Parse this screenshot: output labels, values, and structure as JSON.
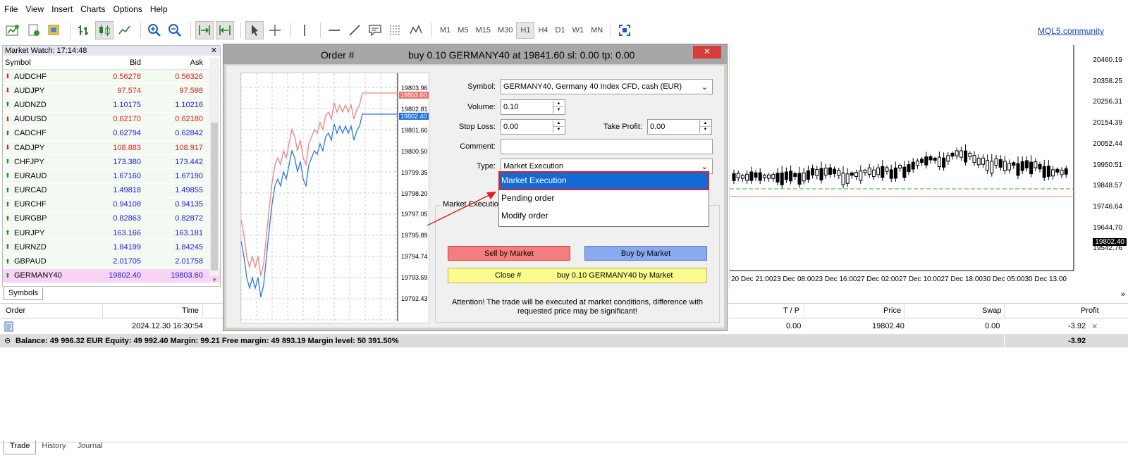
{
  "menu": [
    "File",
    "View",
    "Insert",
    "Charts",
    "Options",
    "Help"
  ],
  "toolbar": {
    "timeframes": [
      "M1",
      "M5",
      "M15",
      "M30",
      "H1",
      "H4",
      "D1",
      "W1",
      "MN"
    ],
    "active_timeframe": "H1",
    "community_link": "MQL5.community"
  },
  "market_watch": {
    "title": "Market Watch: 17:14:48",
    "col_symbol": "Symbol",
    "col_bid": "Bid",
    "col_ask": "Ask",
    "rows": [
      {
        "symbol": "AUDCHF",
        "dir": "down",
        "bid": "0.56278",
        "ask": "0.56326"
      },
      {
        "symbol": "AUDJPY",
        "dir": "down",
        "bid": "97.574",
        "ask": "97.598"
      },
      {
        "symbol": "AUDNZD",
        "dir": "up",
        "bid": "1.10175",
        "ask": "1.10216"
      },
      {
        "symbol": "AUDUSD",
        "dir": "down",
        "bid": "0.62170",
        "ask": "0.62180"
      },
      {
        "symbol": "CADCHF",
        "dir": "up",
        "bid": "0.62794",
        "ask": "0.62842"
      },
      {
        "symbol": "CADJPY",
        "dir": "down",
        "bid": "108.883",
        "ask": "108.917"
      },
      {
        "symbol": "CHFJPY",
        "dir": "up",
        "bid": "173.380",
        "ask": "173.442"
      },
      {
        "symbol": "EURAUD",
        "dir": "up",
        "bid": "1.67160",
        "ask": "1.67190"
      },
      {
        "symbol": "EURCAD",
        "dir": "up",
        "bid": "1.49818",
        "ask": "1.49855"
      },
      {
        "symbol": "EURCHF",
        "dir": "up",
        "bid": "0.94108",
        "ask": "0.94135"
      },
      {
        "symbol": "EURGBP",
        "dir": "up",
        "bid": "0.82863",
        "ask": "0.82872"
      },
      {
        "symbol": "EURJPY",
        "dir": "up",
        "bid": "163.166",
        "ask": "163.181"
      },
      {
        "symbol": "EURNZD",
        "dir": "up",
        "bid": "1.84199",
        "ask": "1.84245"
      },
      {
        "symbol": "GBPAUD",
        "dir": "up",
        "bid": "2.01705",
        "ask": "2.01758"
      },
      {
        "symbol": "GERMANY40",
        "dir": "up",
        "bid": "19802.40",
        "ask": "19803.60",
        "selected": true
      }
    ],
    "tab": "Symbols"
  },
  "chart": {
    "price_labels": [
      "20460.19",
      "20358.25",
      "20256.31",
      "20154.39",
      "20052.44",
      "19950.51",
      "19848.57",
      "19746.64",
      "19644.70",
      "19542.76"
    ],
    "current_price": "19802.40",
    "time_labels": [
      "20 Dec 21:00",
      "23 Dec 08:00",
      "23 Dec 16:00",
      "27 Dec 02:00",
      "27 Dec 10:00",
      "27 Dec 18:00",
      "30 Dec 05:00",
      "30 Dec 13:00"
    ]
  },
  "dialog": {
    "title": "Order #",
    "subtitle": "buy 0.10 GERMANY40 at 19841.60 sl: 0.00 tp: 0.00",
    "close_label": "✕",
    "mini_prices": [
      "19803.96",
      "19802.81",
      "19801.66",
      "19800.50",
      "19799.35",
      "19798.20",
      "19797.05",
      "19795.89",
      "19794.74",
      "19793.59",
      "19792.43"
    ],
    "ask_tag": "19803.60",
    "bid_tag": "19802.40",
    "symbol_label": "Symbol:",
    "symbol_value": "GERMANY40, Germany 40 Index CFD, cash (EUR)",
    "volume_label": "Volume:",
    "volume_value": "0.10",
    "sl_label": "Stop Loss:",
    "sl_value": "0.00",
    "tp_label": "Take Profit:",
    "tp_value": "0.00",
    "comment_label": "Comment:",
    "comment_value": "",
    "type_label": "Type:",
    "type_value": "Market Execution",
    "group_label": "Market Execution",
    "sell_label": "Sell by Market",
    "buy_label": "Buy by Market",
    "close_order_prefix": "Close #",
    "close_order_text": "buy 0.10 GERMANY40 by Market",
    "attention": "Attention! The trade will be executed at market conditions, difference with requested price may be significant!",
    "dropdown_options": [
      "Market Execution",
      "Pending order",
      "Modify order"
    ]
  },
  "terminal": {
    "col_order": "Order",
    "col_time": "Time",
    "col_tp": "T / P",
    "col_price": "Price",
    "col_swap": "Swap",
    "col_profit": "Profit",
    "row": {
      "time": "2024.12.30 16:30:54",
      "tp": "0.00",
      "price": "19802.40",
      "swap": "0.00",
      "profit": "-3.92"
    },
    "balance_line": "Balance: 49 996.32 EUR  Equity: 49 992.40  Margin: 99.21  Free margin: 49 893.19  Margin level: 50 391.50%",
    "balance_profit": "-3.92",
    "tabs": [
      "Trade",
      "History",
      "Journal"
    ]
  }
}
